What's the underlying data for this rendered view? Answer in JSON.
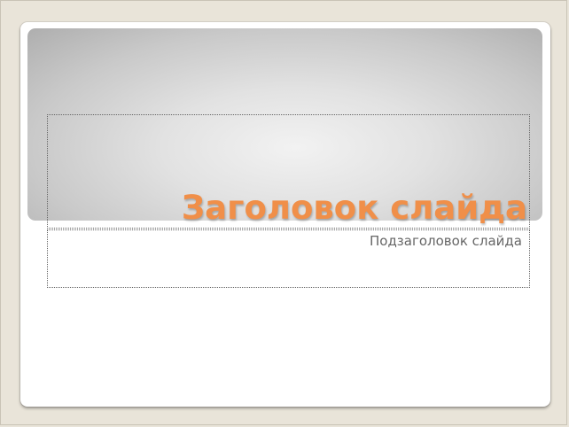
{
  "slide": {
    "title": "Заголовок слайда",
    "subtitle": "Подзаголовок слайда"
  },
  "colors": {
    "title_text": "#f08f49",
    "subtitle_text": "#666666",
    "workspace_background": "#e9e4d9",
    "slide_background": "#ffffff"
  }
}
